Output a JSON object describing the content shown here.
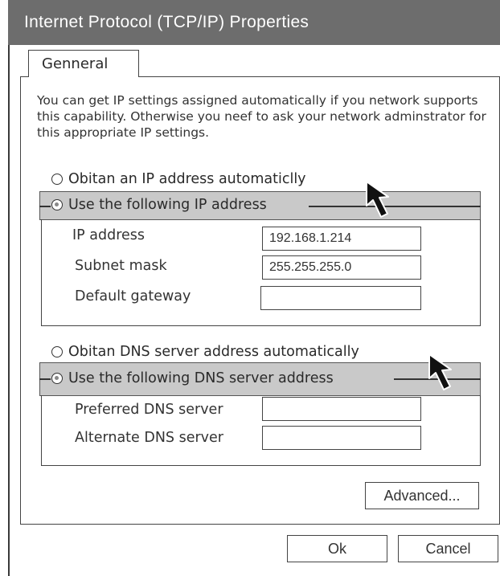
{
  "window": {
    "title": "Internet Protocol (TCP/IP) Properties"
  },
  "tabs": [
    {
      "label": "Genneral"
    }
  ],
  "description": "You can get IP settings assigned automatically if you network supports this capability. Otherwise you neef to ask your network adminstrator for this appropriate IP settings.",
  "ip_section": {
    "auto_option": {
      "label": "Obitan an IP address automaticlly",
      "selected": false
    },
    "manual_option": {
      "label": "Use the following IP address",
      "selected": true
    },
    "fields": [
      {
        "label": "IP address",
        "value": "192.168.1.214"
      },
      {
        "label": "Subnet mask",
        "value": "255.255.255.0"
      },
      {
        "label": "Default gateway",
        "value": ""
      }
    ]
  },
  "dns_section": {
    "auto_option": {
      "label": "Obitan DNS server address automatically",
      "selected": false
    },
    "manual_option": {
      "label": "Use the following DNS server address",
      "selected": true
    },
    "fields": [
      {
        "label": "Preferred DNS server",
        "value": ""
      },
      {
        "label": "Alternate DNS server",
        "value": ""
      }
    ]
  },
  "buttons": {
    "advanced": "Advanced...",
    "ok": "Ok",
    "cancel": "Cancel"
  },
  "colors": {
    "titlebar": "#6d6d6d",
    "group_header": "#c9c9c9",
    "border": "#444444"
  },
  "icons": [
    "mouse-pointer-icon"
  ]
}
